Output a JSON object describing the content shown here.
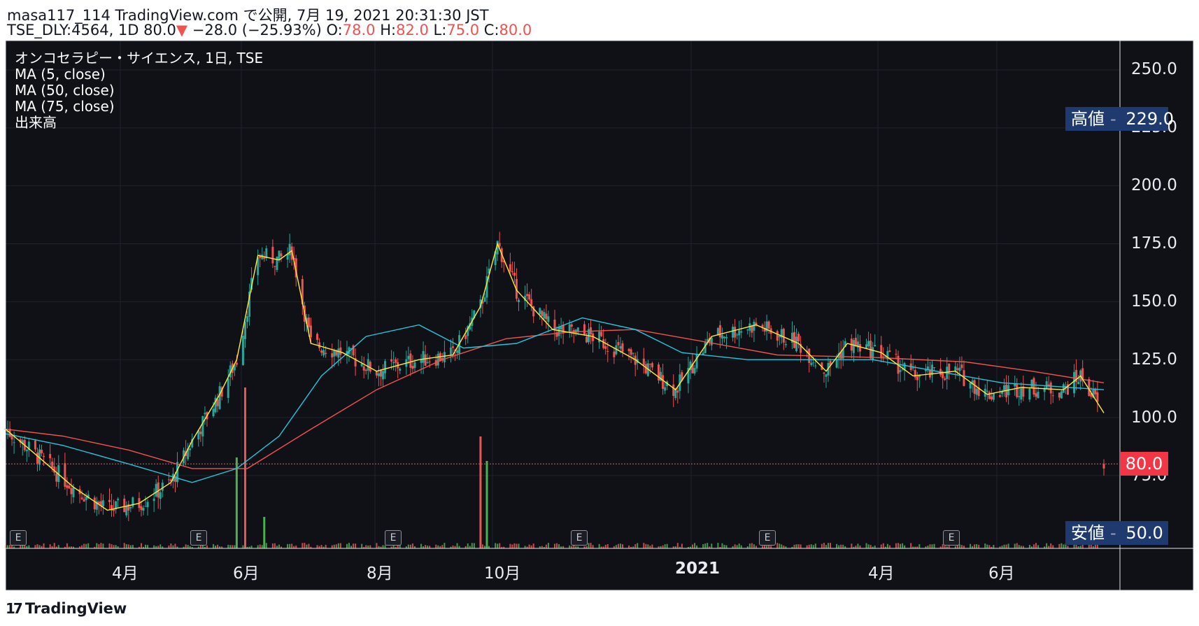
{
  "header": {
    "line1": "masa117_114 TradingView.com で公開, 7月 19, 2021 20:31:30 JST",
    "symbol": "TSE_DLY:4564, 1D 80.0",
    "arrow": "▼",
    "change": "−28.0 (−25.93%)",
    "o_label": "O:",
    "o_value": "78.0",
    "h_label": "H:",
    "h_value": "82.0",
    "l_label": "L:",
    "l_value": "75.0",
    "c_label": "C:",
    "c_value": "80.0"
  },
  "legend": {
    "title": "オンコセラピー・サイエンス, 1日, TSE",
    "ma5": "MA (5, close)",
    "ma50": "MA (50, close)",
    "ma75": "MA (75, close)",
    "volume": "出来高"
  },
  "price_axis": {
    "ticks": [
      "250.0",
      "225.0",
      "200.0",
      "175.0",
      "150.0",
      "125.0",
      "100.0",
      "75.0"
    ]
  },
  "time_axis": {
    "ticks": [
      "4月",
      "6月",
      "8月",
      "10月",
      "2021",
      "4月",
      "6月"
    ]
  },
  "tags": {
    "high_label": "高値",
    "high_value": "229.0",
    "last_value": "80.0",
    "low_label": "安値",
    "low_value": "50.0"
  },
  "events": [
    "E",
    "E",
    "E",
    "E",
    "E",
    "E"
  ],
  "footer": {
    "logo_mark": "17",
    "logo_text": "TradingView"
  },
  "colors": {
    "background": "#0f1117",
    "up": "#26a69a",
    "up_volume": "#4caf50",
    "down": "#ef5350",
    "ma5": "#ffeb3b",
    "ma50": "#26c6da",
    "ma75": "#ef5350",
    "tag_bg": "#1e3a6e",
    "last_tag_bg": "#f23645"
  },
  "chart_data": {
    "type": "candlestick",
    "symbol": "TSE_DLY:4564",
    "ylim": [
      50,
      260
    ],
    "ohlc_last": {
      "open": 78.0,
      "high": 82.0,
      "low": 75.0,
      "close": 80.0
    },
    "ma5": [
      [
        "2020-02-17",
        95
      ],
      [
        "2020-03-01",
        85
      ],
      [
        "2020-03-20",
        70
      ],
      [
        "2020-04-05",
        60
      ],
      [
        "2020-04-20",
        63
      ],
      [
        "2020-05-05",
        72
      ],
      [
        "2020-05-15",
        90
      ],
      [
        "2020-05-28",
        110
      ],
      [
        "2020-06-05",
        125
      ],
      [
        "2020-06-15",
        170
      ],
      [
        "2020-06-25",
        168
      ],
      [
        "2020-07-01",
        172
      ],
      [
        "2020-07-10",
        132
      ],
      [
        "2020-07-25",
        128
      ],
      [
        "2020-08-10",
        120
      ],
      [
        "2020-08-30",
        125
      ],
      [
        "2020-09-15",
        127
      ],
      [
        "2020-09-28",
        148
      ],
      [
        "2020-10-06",
        175
      ],
      [
        "2020-10-15",
        155
      ],
      [
        "2020-11-01",
        138
      ],
      [
        "2020-11-20",
        135
      ],
      [
        "2020-12-10",
        125
      ],
      [
        "2020-12-29",
        112
      ],
      [
        "2021-01-15",
        135
      ],
      [
        "2021-02-05",
        140
      ],
      [
        "2021-02-25",
        132
      ],
      [
        "2021-03-10",
        120
      ],
      [
        "2021-03-20",
        132
      ],
      [
        "2021-04-05",
        128
      ],
      [
        "2021-04-20",
        118
      ],
      [
        "2021-05-10",
        120
      ],
      [
        "2021-05-25",
        110
      ],
      [
        "2021-06-10",
        113
      ],
      [
        "2021-06-30",
        112
      ],
      [
        "2021-07-08",
        118
      ],
      [
        "2021-07-19",
        102
      ]
    ],
    "ma50": [
      [
        "2020-02-17",
        93
      ],
      [
        "2020-03-15",
        88
      ],
      [
        "2020-04-15",
        80
      ],
      [
        "2020-05-15",
        72
      ],
      [
        "2020-06-05",
        78
      ],
      [
        "2020-06-25",
        92
      ],
      [
        "2020-07-15",
        118
      ],
      [
        "2020-08-05",
        135
      ],
      [
        "2020-08-30",
        140
      ],
      [
        "2020-09-20",
        130
      ],
      [
        "2020-10-15",
        132
      ],
      [
        "2020-11-15",
        143
      ],
      [
        "2020-12-10",
        138
      ],
      [
        "2021-01-01",
        128
      ],
      [
        "2021-02-01",
        125
      ],
      [
        "2021-03-01",
        125
      ],
      [
        "2021-04-01",
        125
      ],
      [
        "2021-05-01",
        120
      ],
      [
        "2021-06-01",
        115
      ],
      [
        "2021-07-19",
        112
      ]
    ],
    "ma75": [
      [
        "2020-02-17",
        95
      ],
      [
        "2020-03-15",
        92
      ],
      [
        "2020-04-15",
        86
      ],
      [
        "2020-05-15",
        78
      ],
      [
        "2020-06-10",
        78
      ],
      [
        "2020-07-10",
        95
      ],
      [
        "2020-08-10",
        112
      ],
      [
        "2020-09-10",
        125
      ],
      [
        "2020-10-10",
        134
      ],
      [
        "2020-11-10",
        137
      ],
      [
        "2020-12-10",
        138
      ],
      [
        "2021-01-10",
        133
      ],
      [
        "2021-02-15",
        127
      ],
      [
        "2021-04-01",
        126
      ],
      [
        "2021-05-15",
        124
      ],
      [
        "2021-06-15",
        120
      ],
      [
        "2021-07-19",
        115
      ]
    ],
    "volume_spikes": [
      [
        "2020-06-05",
        "high"
      ],
      [
        "2020-06-09",
        "high"
      ],
      [
        "2020-06-18",
        "high"
      ],
      [
        "2020-09-28",
        "high"
      ],
      [
        "2020-10-01",
        "high"
      ]
    ],
    "price_tags": {
      "high": 229.0,
      "last": 80.0,
      "low": 50.0
    }
  }
}
